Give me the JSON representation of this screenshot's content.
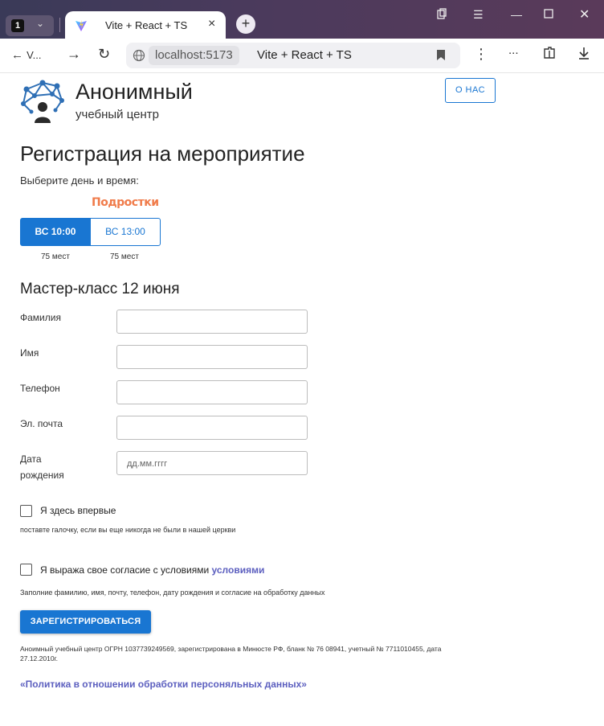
{
  "browser": {
    "tab_count": "1",
    "tab_title": "Vite + React + TS",
    "address_host": "localhost:5173",
    "address_title": "Vite + React + TS",
    "back_label": "V...",
    "more_label": "..."
  },
  "colors": {
    "primary": "#1976d2",
    "accent_orange": "#f07b4a",
    "link": "#5c5fbf"
  },
  "header": {
    "brand_title": "Анонимный",
    "brand_subtitle": "учебный центр",
    "about_button": "О НАС"
  },
  "form": {
    "title": "Регистрация на мероприятие",
    "choose_label": "Выберите день и время:",
    "group_tag": "Подростки",
    "slots": [
      {
        "label": "ВС 10:00",
        "seats": "75 мест",
        "selected": true
      },
      {
        "label": "ВС 13:00",
        "seats": "75 мест",
        "selected": false
      }
    ],
    "event_title": "Мастер-класс 12 июня",
    "fields": {
      "last_name": {
        "label": "Фамилия",
        "value": ""
      },
      "first_name": {
        "label": "Имя",
        "value": ""
      },
      "phone": {
        "label": "Телефон",
        "value": ""
      },
      "email": {
        "label": "Эл. почта",
        "value": ""
      },
      "birth_date": {
        "label_line1": "Дата",
        "label_line2": "рождения",
        "placeholder": "дд.мм.гггг"
      }
    },
    "first_time": {
      "label": "Я здесь впервые",
      "hint": "поставте галочку, если вы еще никогда не были в нашей церкви",
      "checked": false
    },
    "consent": {
      "label": "Я выража свое согласие с условиями",
      "link": "условиями",
      "checked": false
    },
    "fill_hint": "Заполние фамилию, имя, почту, телефон, дату рождения и согласие на обработку данных",
    "submit_button": "ЗАРЕГИСТРИРОВАТЬСЯ"
  },
  "footer": {
    "legal": "Аноимный учебный центр ОГРН 1037739249569, зарегистрирована в Минюсте РФ, бланк № 76 08941, учетный № 7711010455, дата 27.12.2010г.",
    "policy_link": "«Политика в отношении обработки персоняльных данных»"
  }
}
